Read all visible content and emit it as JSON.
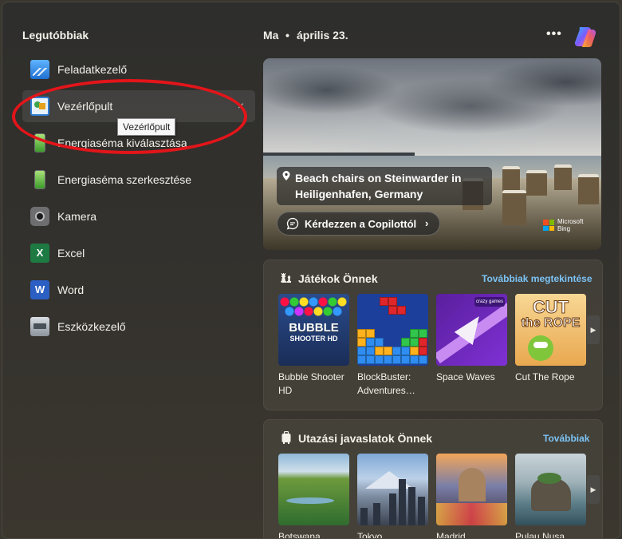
{
  "left": {
    "title": "Legutóbbiak",
    "items": [
      {
        "label": "Feladatkezelő",
        "icon": "task-manager-icon"
      },
      {
        "label": "Vezérlőpult",
        "icon": "control-panel-icon"
      },
      {
        "label": "Energiaséma kiválasztása",
        "icon": "battery-icon"
      },
      {
        "label": "Energiaséma szerkesztése",
        "icon": "battery-icon"
      },
      {
        "label": "Kamera",
        "icon": "camera-icon"
      },
      {
        "label": "Excel",
        "icon": "excel-icon"
      },
      {
        "label": "Word",
        "icon": "word-icon"
      },
      {
        "label": "Eszközkezelő",
        "icon": "device-manager-icon"
      }
    ],
    "remove_glyph": "×",
    "tooltip": "Vezérlőpult"
  },
  "header": {
    "day": "Ma",
    "separator": "•",
    "date": "április 23.",
    "more": "•••"
  },
  "hero": {
    "caption": "Beach chairs on Steinwarder in Heiligenhafen, Germany",
    "ask_button": "Kérdezzen a Copilottól",
    "chevron": "›",
    "brand_line1": "Microsoft",
    "brand_line2": "Bing"
  },
  "games": {
    "title": "Játékok Önnek",
    "link": "Továbbiak megtekintése",
    "items": [
      {
        "label": "Bubble Shooter HD",
        "art_line1": "BUBBLE",
        "art_line2": "SHOOTER HD"
      },
      {
        "label": "BlockBuster: Adventures…"
      },
      {
        "label": "Space Waves",
        "art_badge": "crazy games"
      },
      {
        "label": "Cut The Rope",
        "art_line1": "CUT",
        "art_line2": "the ROPE"
      }
    ],
    "next_arrow": "▶"
  },
  "travel": {
    "title": "Utazási javaslatok Önnek",
    "link": "Továbbiak",
    "items": [
      {
        "label": "Botswana"
      },
      {
        "label": "Tokyo"
      },
      {
        "label": "Madrid"
      },
      {
        "label": "Pulau Nusa"
      }
    ],
    "next_arrow": "▶"
  },
  "colors": {
    "accent_link": "#7cc3f5",
    "annotation": "#e3151a",
    "panel_bg": "#2e2e2c"
  }
}
